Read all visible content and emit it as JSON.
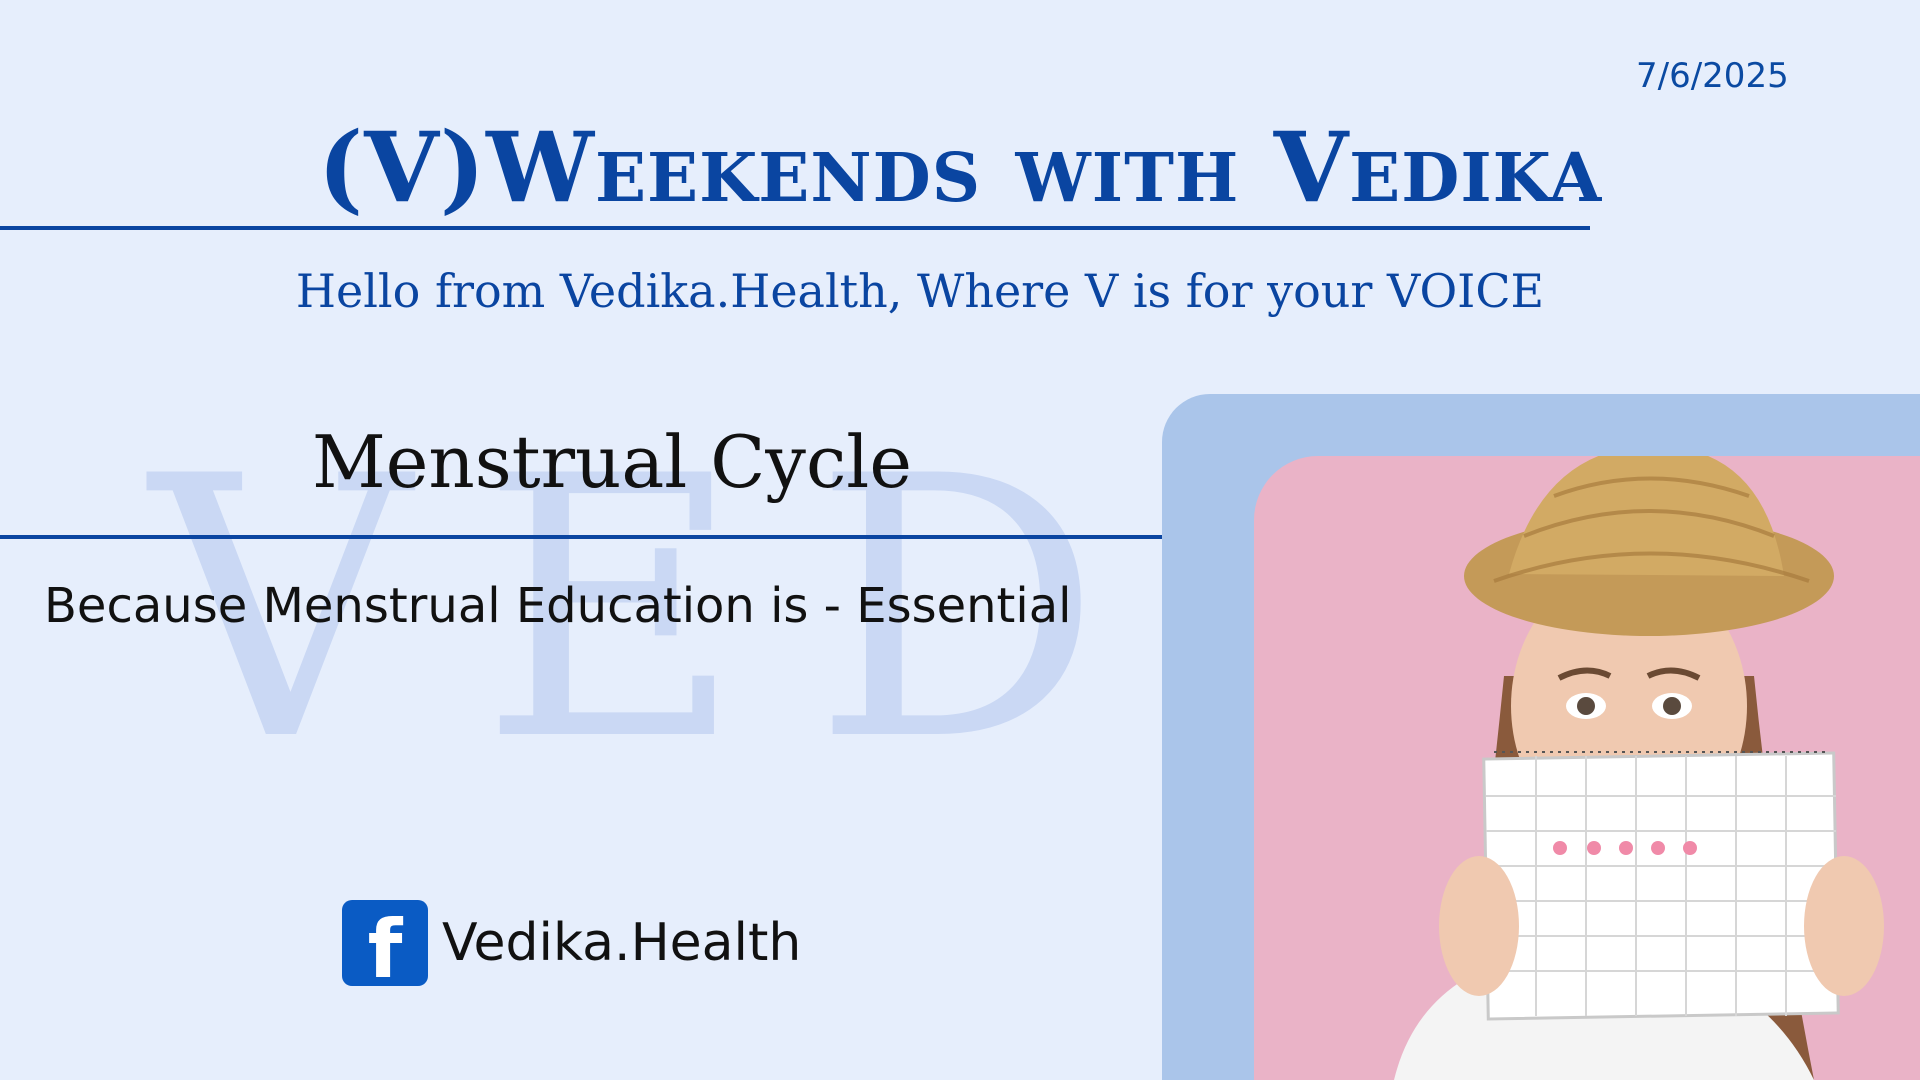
{
  "header": {
    "date": "7/6/2025",
    "title": "(V)Weekends with Vedika",
    "subtitle": "Hello from Vedika.Health, Where V is for your VOICE"
  },
  "content": {
    "watermark": "VEDIK",
    "topic": "Menstrual Cycle",
    "tagline": "Because Menstrual Education is - Essential"
  },
  "footer": {
    "social_icon": "facebook-icon",
    "social_glyph": "f",
    "social_name": "Vedika.Health"
  },
  "photo": {
    "subject": "woman-with-straw-hat-holding-calendar"
  },
  "colors": {
    "background": "#e6eefc",
    "brand_blue": "#0a45a1",
    "frame_blue": "#aac5ea",
    "photo_pink": "#eab3c7"
  }
}
